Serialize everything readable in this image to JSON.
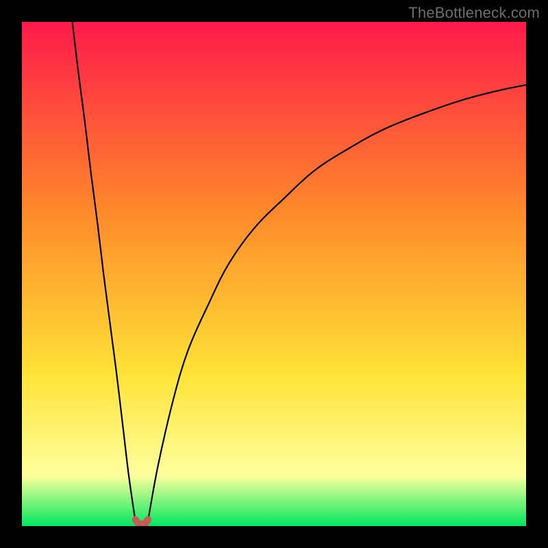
{
  "watermark": "TheBottleneck.com",
  "gradient": {
    "top": "#ff1a4b",
    "orange": "#ff8a2a",
    "yellow": "#ffe337",
    "pale_yellow": "#ffff9e",
    "green": "#00e85e"
  },
  "marker": {
    "color": "#c95a5a",
    "stroke": "#8e3a3a"
  },
  "curve_color": "#000000",
  "chart_data": {
    "type": "line",
    "title": "",
    "xlabel": "",
    "ylabel": "",
    "xlim": [
      0,
      100
    ],
    "ylim": [
      0,
      100
    ],
    "grid": false,
    "legend": false,
    "annotations": [
      "TheBottleneck.com"
    ],
    "series": [
      {
        "name": "left-branch",
        "x": [
          10.0,
          11.2,
          12.5,
          13.7,
          15.0,
          16.2,
          17.5,
          18.8,
          20.0,
          21.2,
          22.5
        ],
        "y": [
          100.0,
          90.0,
          80.0,
          70.0,
          60.0,
          50.0,
          40.0,
          30.0,
          20.0,
          10.0,
          1.0
        ]
      },
      {
        "name": "right-branch",
        "x": [
          25.0,
          27.0,
          30.0,
          33.0,
          37.0,
          41.0,
          46.0,
          52.0,
          58.0,
          65.0,
          72.0,
          80.0,
          88.0,
          95.0,
          100.0
        ],
        "y": [
          1.0,
          12.0,
          25.0,
          35.0,
          44.0,
          52.0,
          59.0,
          65.0,
          70.5,
          75.0,
          78.8,
          82.0,
          84.7,
          86.5,
          87.5
        ]
      },
      {
        "name": "optimal-marker",
        "x": [
          22.5,
          23.0,
          23.5,
          24.0,
          24.5,
          25.0
        ],
        "y": [
          1.3,
          0.6,
          0.4,
          0.4,
          0.6,
          1.3
        ]
      }
    ]
  }
}
